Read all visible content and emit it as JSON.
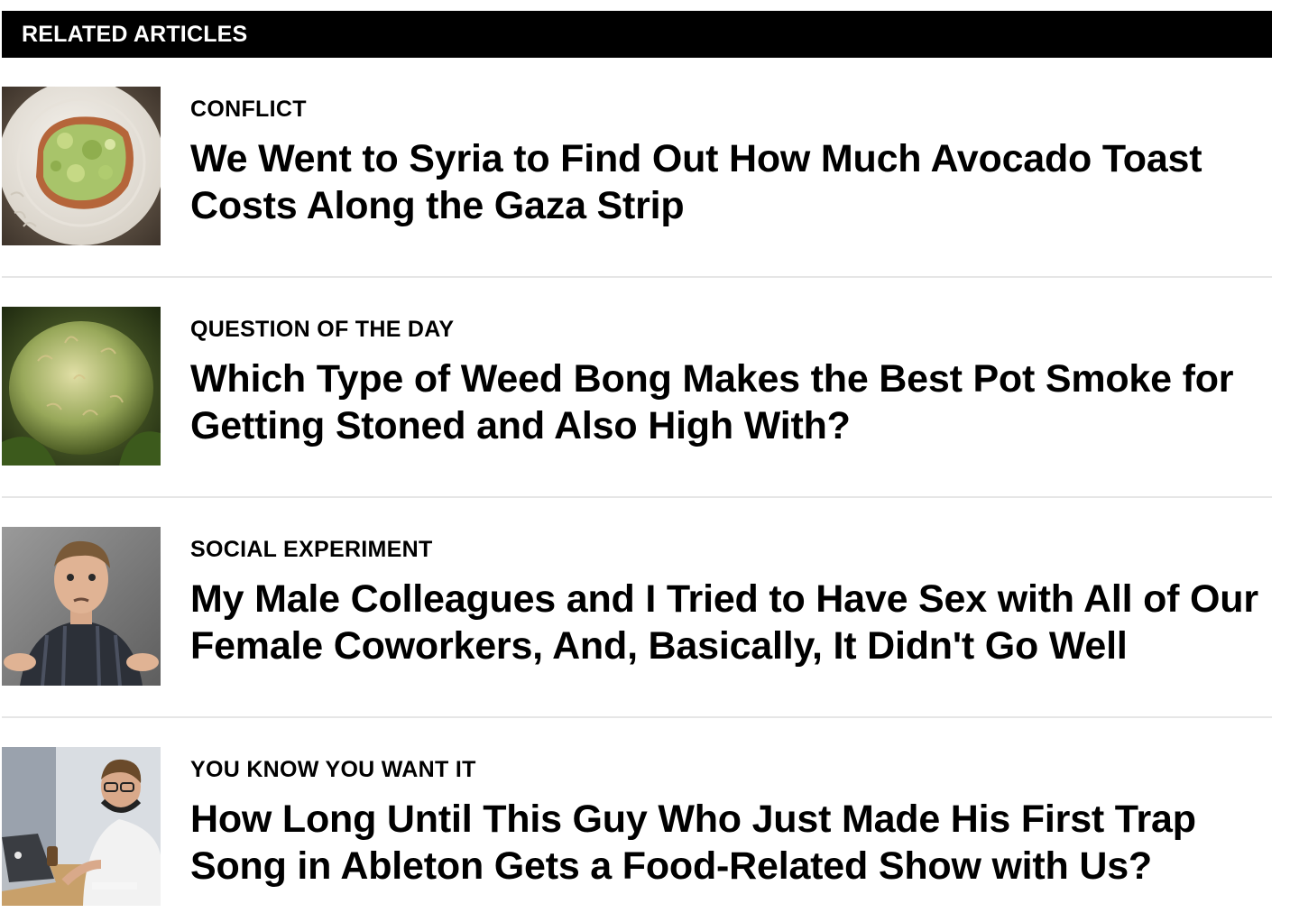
{
  "section": {
    "title": "RELATED ARTICLES"
  },
  "articles": [
    {
      "category": "CONFLICT",
      "headline": "We Went to Syria to Find Out How Much Avocado Toast Costs Along the Gaza Strip",
      "thumbnail_icon": "avocado-toast-photo"
    },
    {
      "category": "QUESTION OF THE DAY",
      "headline": "Which Type of Weed Bong Makes the Best Pot Smoke for Getting Stoned and Also High With?",
      "thumbnail_icon": "cannabis-bud-photo"
    },
    {
      "category": "SOCIAL EXPERIMENT",
      "headline": "My Male Colleagues and I Tried to Have Sex with All of Our Female Coworkers, And, Basically, It Didn't Go Well",
      "thumbnail_icon": "shrugging-man-photo"
    },
    {
      "category": "YOU KNOW YOU WANT IT",
      "headline": "How Long Until This Guy Who Just Made His First Trap Song in Ableton Gets a Food-Related Show with Us?",
      "thumbnail_icon": "man-at-laptop-photo"
    }
  ]
}
